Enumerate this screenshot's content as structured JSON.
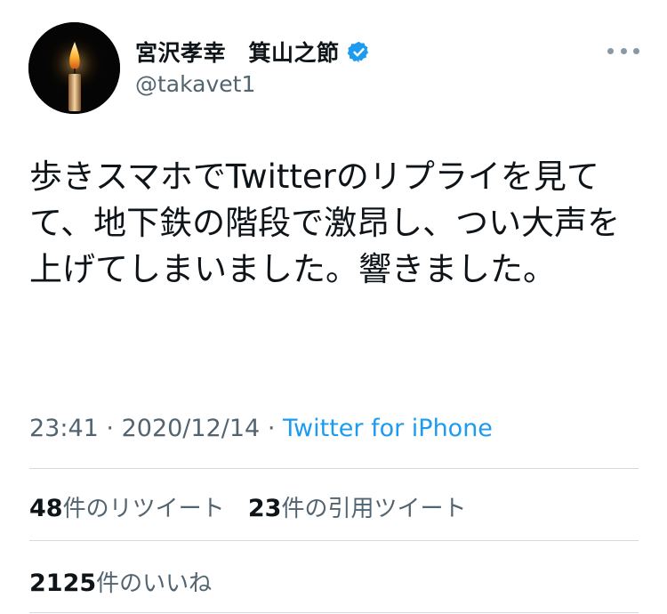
{
  "user": {
    "display_name": "宮沢孝幸　箕山之節",
    "handle": "@takavet1",
    "verified": true,
    "avatar_icon": "candle-icon"
  },
  "tweet": {
    "text": "歩きスマホでTwitterのリプライを見てて、地下鉄の階段で激昂し、つい大声を上げてしまいました。響きました。",
    "time": "23:41",
    "separator": "·",
    "date": "2020/12/14",
    "source": "Twitter for iPhone"
  },
  "stats": {
    "retweets_count": "48",
    "retweets_label": "件のリツイート",
    "quotes_count": "23",
    "quotes_label": "件の引用ツイート",
    "likes_count": "2125",
    "likes_label": "件のいいね"
  },
  "icons": {
    "more": "more-horizontal-icon",
    "verified": "verified-badge-icon"
  },
  "colors": {
    "accent": "#1d9bf0",
    "secondary_text": "#536471",
    "primary_text": "#0f1419",
    "divider": "#d6dadd"
  }
}
